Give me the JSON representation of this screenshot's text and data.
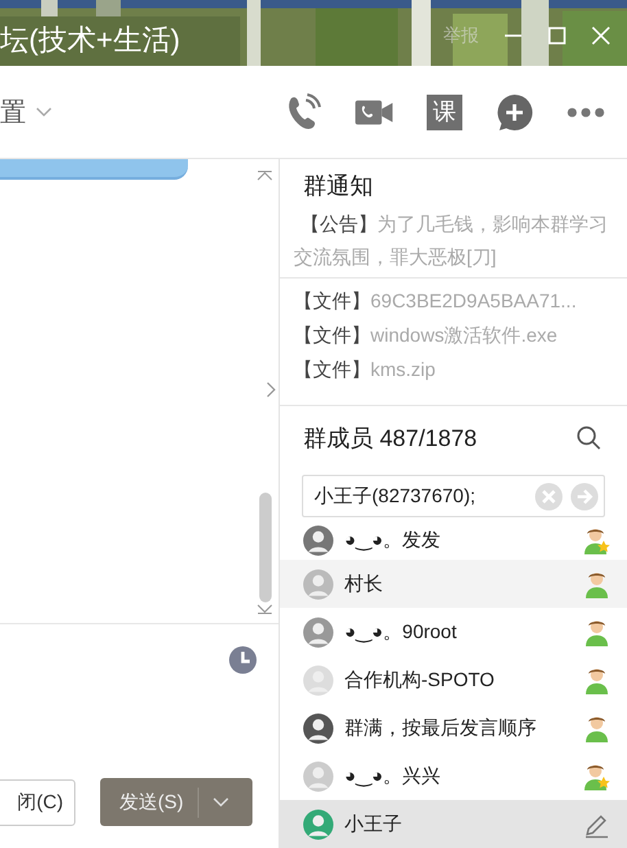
{
  "window": {
    "title": "坛(技术+生活)",
    "report": "举报"
  },
  "toolbar": {
    "settings_label": "置",
    "tool_label": "课"
  },
  "composer": {
    "buttons": [
      {
        "label": "闭(C)",
        "kind": "plain"
      },
      {
        "label": "发送(S)",
        "kind": "primary"
      }
    ]
  },
  "notice": {
    "title": "群通知",
    "tag": "【公告】",
    "text": "为了几毛钱，影响本群学习交流氛围，罪大恶极[刀]",
    "files": [
      {
        "tag": "【文件】",
        "name": "69C3BE2D9A5BAA71..."
      },
      {
        "tag": "【文件】",
        "name": "windows激活软件.exe"
      },
      {
        "tag": "【文件】",
        "name": "kms.zip"
      }
    ]
  },
  "members": {
    "title": "群成员 487/1878",
    "search": {
      "value": "小王子(82737670);"
    },
    "items": [
      {
        "name": "◕‿◕。发发",
        "kind": "admin",
        "hovered": false,
        "selected": false
      },
      {
        "name": "村长",
        "kind": "member",
        "hovered": true,
        "selected": false
      },
      {
        "name": "◕‿◕。90root",
        "kind": "member",
        "hovered": false,
        "selected": false
      },
      {
        "name": "合作机构-SPOTO",
        "kind": "member",
        "hovered": false,
        "selected": false
      },
      {
        "name": "群满，按最后发言顺序",
        "kind": "member",
        "hovered": false,
        "selected": false
      },
      {
        "name": "◕‿◕。兴兴",
        "kind": "admin",
        "hovered": false,
        "selected": false
      },
      {
        "name": "小王子",
        "kind": "self",
        "hovered": false,
        "selected": true
      }
    ]
  }
}
